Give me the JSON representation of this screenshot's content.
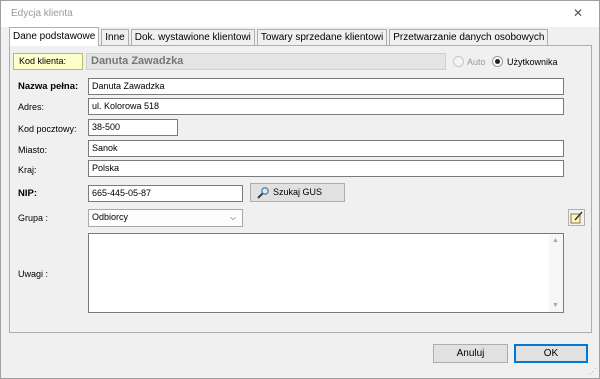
{
  "window": {
    "title": "Edycja klienta",
    "close_icon": "close-icon"
  },
  "tabs": [
    {
      "label": "Dane podstawowe",
      "active": true
    },
    {
      "label": "Inne",
      "active": false
    },
    {
      "label": "Dok. wystawione klientowi",
      "active": false
    },
    {
      "label": "Towary sprzedane klientowi",
      "active": false
    },
    {
      "label": "Przetwarzanie danych osobowych",
      "active": false
    }
  ],
  "form": {
    "kod_label": "Kod klienta:",
    "kod_value": "Danuta Zawadzka",
    "radio_auto_label": "Auto",
    "radio_user_label": "Użytkownika",
    "radio_selected": "Użytkownika",
    "nazwa_label": "Nazwa pełna:",
    "nazwa_value": "Danuta Zawadzka",
    "adres_label": "Adres:",
    "adres_value": "ul. Kolorowa 518",
    "kod_pocztowy_label": "Kod pocztowy:",
    "kod_pocztowy_value": "38-500",
    "miasto_label": "Miasto:",
    "miasto_value": "Sanok",
    "kraj_label": "Kraj:",
    "kraj_value": "Polska",
    "nip_label": "NIP:",
    "nip_value": "665-445-05-87",
    "szukaj_gus_label": "Szukaj GUS",
    "grupa_label": "Grupa :",
    "grupa_value": "Odbiorcy",
    "uwagi_label": "Uwagi :",
    "uwagi_value": ""
  },
  "footer": {
    "cancel_label": "Anuluj",
    "ok_label": "OK"
  },
  "colors": {
    "accent": "#0078d7",
    "kod_label_bg": "#ffffcc"
  }
}
